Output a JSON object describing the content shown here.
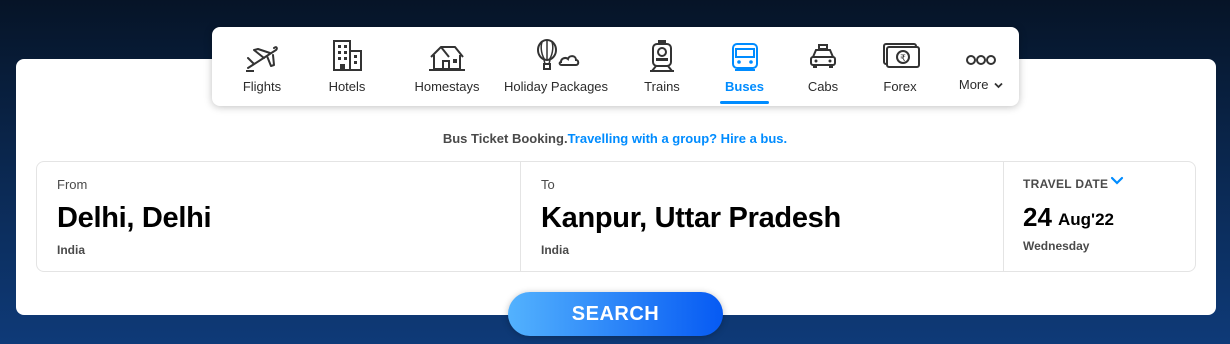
{
  "nav": {
    "items": [
      {
        "label": "Flights",
        "icon": "airplane-icon"
      },
      {
        "label": "Hotels",
        "icon": "building-icon"
      },
      {
        "label": "Homestays",
        "icon": "house-icon"
      },
      {
        "label": "Holiday Packages",
        "icon": "hot-air-balloon-icon"
      },
      {
        "label": "Trains",
        "icon": "train-icon"
      },
      {
        "label": "Buses",
        "icon": "bus-icon"
      },
      {
        "label": "Cabs",
        "icon": "taxi-icon"
      },
      {
        "label": "Forex",
        "icon": "currency-note-icon"
      },
      {
        "label": "More",
        "icon": "more-dots-icon"
      }
    ],
    "active": "Buses"
  },
  "tagline": {
    "text": "Bus Ticket Booking.",
    "link": "Travelling with a group? Hire a bus."
  },
  "from": {
    "label": "From",
    "city": "Delhi, Delhi",
    "country": "India"
  },
  "to": {
    "label": "To",
    "city": "Kanpur, Uttar Pradesh",
    "country": "India"
  },
  "travel_date": {
    "label": "TRAVEL DATE",
    "day": "24",
    "month_year": "Aug'22",
    "weekday": "Wednesday"
  },
  "search": {
    "label": "SEARCH"
  },
  "colors": {
    "accent": "#008cff",
    "button_gradient_start": "#53b2fe",
    "button_gradient_end": "#065af3"
  }
}
